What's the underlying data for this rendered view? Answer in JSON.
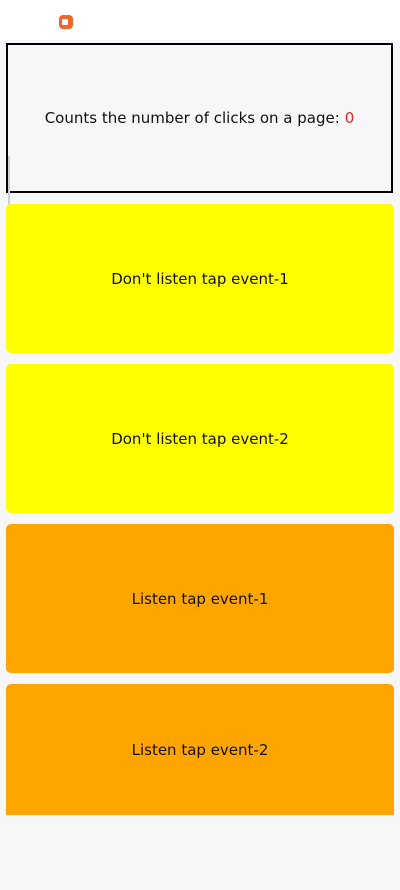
{
  "status_bar": {
    "record_icon": "screen-record-icon",
    "record_icon_color": "#f0642d"
  },
  "counter": {
    "label": "Counts the number of clicks on a page:",
    "value": "0",
    "value_color": "#e0261f"
  },
  "tiles": [
    {
      "label": "Don't listen tap event-1",
      "color": "#ffff00"
    },
    {
      "label": "Don't listen tap event-2",
      "color": "#ffff00"
    },
    {
      "label": "Listen tap event-1",
      "color": "#ffa500"
    },
    {
      "label": "Listen tap event-2",
      "color": "#ffa500"
    }
  ]
}
